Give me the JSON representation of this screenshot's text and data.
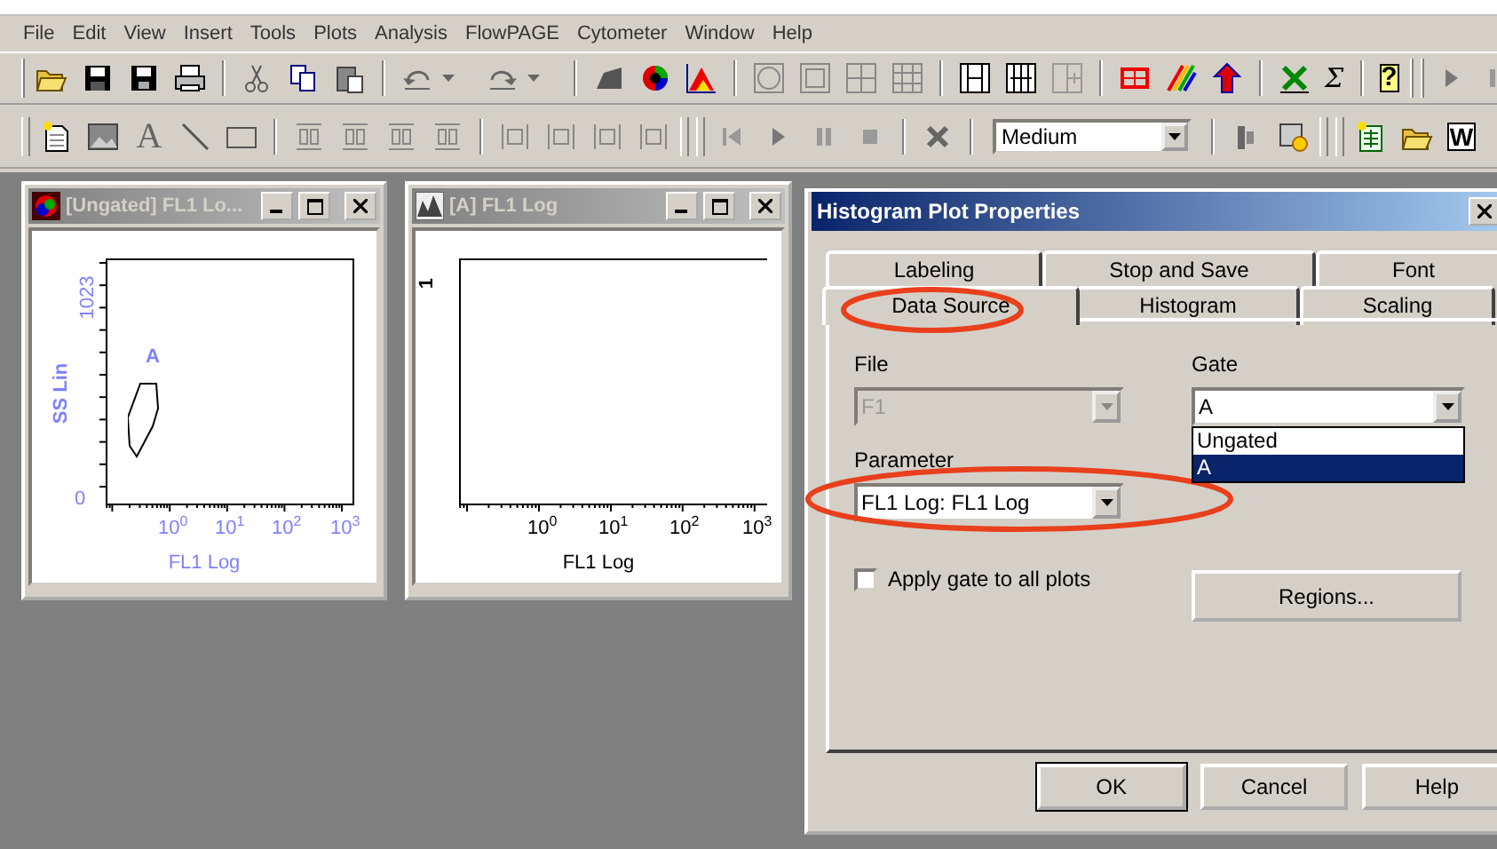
{
  "menu": [
    "File",
    "Edit",
    "View",
    "Insert",
    "Tools",
    "Plots",
    "Analysis",
    "FlowPAGE",
    "Cytometer",
    "Window",
    "Help"
  ],
  "toolbar_1": {
    "sum_tool": "Σ",
    "help_tool": "?"
  },
  "toolbar_2": {
    "text_tool": "A",
    "speed_combo": "Medium",
    "word_tool": "W"
  },
  "plot_windows": [
    {
      "title": "[Ungated] FL1 Lo...",
      "kind": "dot_plot",
      "active": false,
      "y_label": "SS Lin",
      "y_ticks": [
        "0",
        "1023"
      ],
      "x_label": "FL1 Log",
      "x_ticks": [
        "10$^{0}$",
        "10$^{1}$",
        "10$^{2}$",
        "10$^{3}$"
      ],
      "gate_label": "A"
    },
    {
      "title": "[A] FL1 Log",
      "kind": "histogram",
      "active": false,
      "y_ticks": [
        "1"
      ],
      "x_label": "FL1 Log",
      "x_ticks": [
        "10$^{0}$",
        "10$^{1}$",
        "10$^{2}$",
        "10$^{3}$"
      ]
    }
  ],
  "dialog": {
    "title": "Histogram Plot Properties",
    "tabs_back": [
      {
        "label": "Labeling",
        "selected": false,
        "highlighted": false
      },
      {
        "label": "Stop and Save",
        "selected": false,
        "highlighted": false
      },
      {
        "label": "Font",
        "selected": false,
        "highlighted": false
      }
    ],
    "tabs_front": [
      {
        "label": "Data Source",
        "selected": true,
        "highlighted": true
      },
      {
        "label": "Histogram",
        "selected": false,
        "highlighted": false
      },
      {
        "label": "Scaling",
        "selected": false,
        "highlighted": false
      }
    ],
    "file": {
      "label": "File",
      "value": "F1",
      "disabled": true
    },
    "gate": {
      "label": "Gate",
      "value": "A",
      "expanded": true,
      "options": [
        {
          "label": "Ungated",
          "selected": false
        },
        {
          "label": "A",
          "selected": true
        }
      ]
    },
    "parameter": {
      "label": "Parameter",
      "value": "FL1 Log: FL1 Log",
      "highlighted": true
    },
    "apply_gate": {
      "label": "Apply gate to all plots",
      "checked": false
    },
    "regions_button": "Regions...",
    "buttons": [
      {
        "label": "OK",
        "default": true
      },
      {
        "label": "Cancel",
        "default": false
      },
      {
        "label": "Help",
        "default": false
      }
    ]
  }
}
